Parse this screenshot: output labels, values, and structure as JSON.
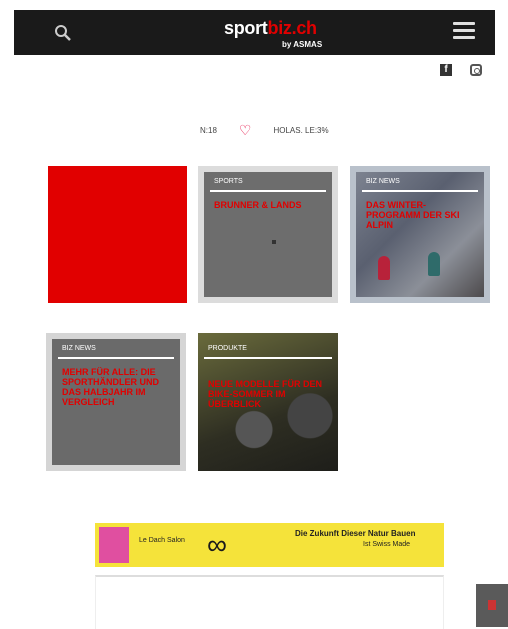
{
  "header": {
    "logo_part1": "sport",
    "logo_part2": "biz.ch",
    "logo_sub": "by ASMAS"
  },
  "filters": {
    "left_label": "N:18",
    "right_label": "HOLAS. LE:3%"
  },
  "cards": [
    {
      "category": "",
      "headline": ""
    },
    {
      "category": "SPORTS",
      "headline": "BRUNNER & LANDS"
    },
    {
      "category": "BIZ NEWS",
      "headline": "DAS WINTER-PROGRAMM DER SKI ALPIN"
    },
    {
      "category": "BIZ NEWS",
      "headline": "MEHR FÜR ALLE: DIE SPORTHÄNDLER UND DAS HALBJAHR IM VERGLEICH"
    },
    {
      "category": "PRODUKTE",
      "headline": "NEUE MODELLE FÜR DEN BIKE-SOMMER IM ÜBERBLICK"
    }
  ],
  "ad": {
    "left_text": "Le Dach Salon",
    "mid_text": "Die Zukunft Dieser Natur Bauen",
    "right_text": "Ist Swiss Made"
  },
  "colors": {
    "brand_red": "#e10000",
    "topbar": "#1a1a1a",
    "ad_yellow": "#f5e33a"
  }
}
